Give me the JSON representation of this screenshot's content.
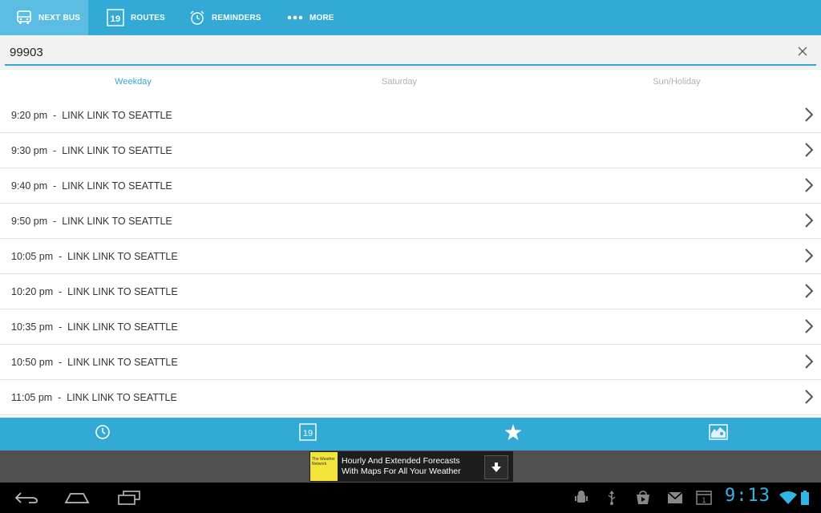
{
  "top_tabs": [
    {
      "label": "NEXT BUS",
      "icon": "bus-icon",
      "active": true
    },
    {
      "label": "ROUTES",
      "icon": "calendar-icon",
      "active": false
    },
    {
      "label": "REMINDERS",
      "icon": "alarm-clock-icon",
      "active": false
    },
    {
      "label": "MORE",
      "icon": "more-dots-icon",
      "active": false
    }
  ],
  "routes_icon_number": "19",
  "search": {
    "value": "99903"
  },
  "day_tabs": [
    {
      "label": "Weekday",
      "selected": true
    },
    {
      "label": "Saturday",
      "selected": false
    },
    {
      "label": "Sun/Holiday",
      "selected": false
    }
  ],
  "schedule": [
    {
      "text": "9:20 pm  -  LINK LINK TO SEATTLE"
    },
    {
      "text": "9:30 pm  -  LINK LINK TO SEATTLE"
    },
    {
      "text": "9:40 pm  -  LINK LINK TO SEATTLE"
    },
    {
      "text": "9:50 pm  -  LINK LINK TO SEATTLE"
    },
    {
      "text": "10:05 pm  -  LINK LINK TO SEATTLE"
    },
    {
      "text": "10:20 pm  -  LINK LINK TO SEATTLE"
    },
    {
      "text": "10:35 pm  -  LINK LINK TO SEATTLE"
    },
    {
      "text": "10:50 pm  -  LINK LINK TO SEATTLE"
    },
    {
      "text": "11:05 pm  -  LINK LINK TO SEATTLE"
    }
  ],
  "bottom_nav": [
    {
      "icon": "clock-icon"
    },
    {
      "icon": "calendar-icon",
      "number": "19"
    },
    {
      "icon": "star-icon"
    },
    {
      "icon": "map-icon"
    }
  ],
  "ad": {
    "logo_text": "The Weather Network",
    "line1": "Hourly And Extended Forecasts",
    "line2": "With Maps For All Your Weather",
    "icon": "download-icon"
  },
  "status": {
    "time": "9:13"
  },
  "colors": {
    "accent": "#33a9d6",
    "active_tab": "#5cbde2",
    "clock": "#33b5e5"
  }
}
